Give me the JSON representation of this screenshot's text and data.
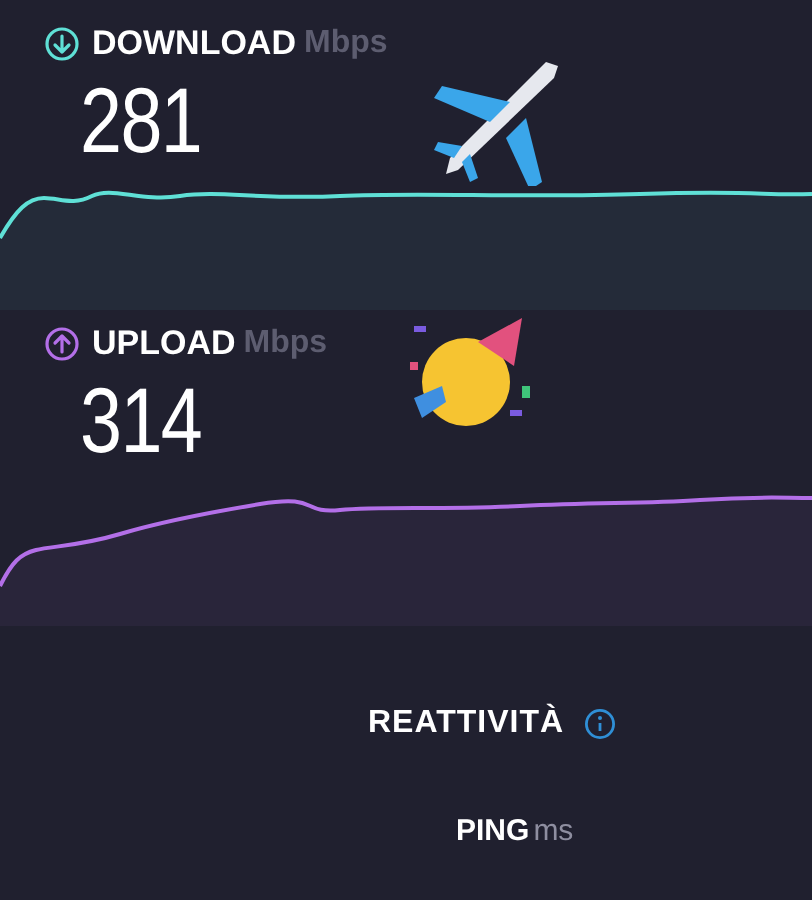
{
  "tests": [
    {
      "kind": "download",
      "label": "DOWNLOAD",
      "unit": "Mbps",
      "value": "281",
      "color": "#5fe0d6"
    },
    {
      "kind": "upload",
      "label": "UPLOAD",
      "unit": "Mbps",
      "value": "314",
      "color": "#b36fe8"
    }
  ],
  "responsiveness": {
    "title": "REATTIVITÀ"
  },
  "ping": {
    "label": "PING",
    "unit": "ms"
  }
}
